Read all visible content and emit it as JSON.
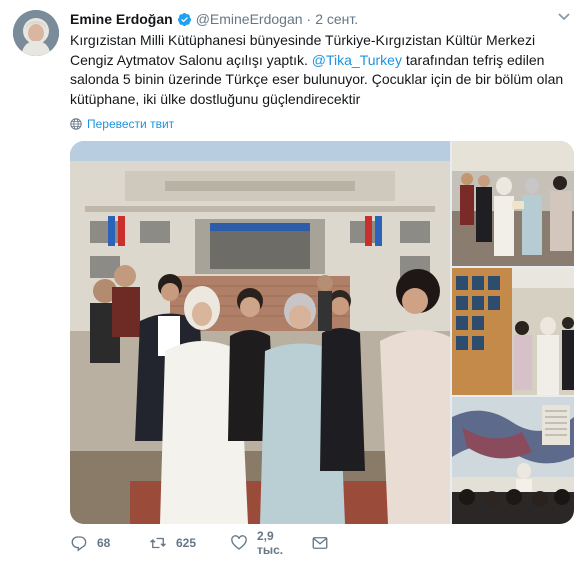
{
  "author": {
    "name": "Emine Erdoğan",
    "handle": "@EmineErdogan",
    "separator": "·",
    "time": "2 сент."
  },
  "tweet": {
    "text_before": "Kırgızistan Milli Kütüphanesi bünyesinde Türkiye-Kırgızistan Kültür Merkezi Cengiz Aytmatov Salonu açılışı yaptık. ",
    "mention": "@Tika_Turkey",
    "text_after": " tarafından tefriş edilen salonda 5 binin üzerinde Türkçe eser bulunuyor. Çocuklar için de bir bölüm olan kütüphane, iki ülke dostluğunu güçlendirecektir"
  },
  "translate_label": "Перевести твит",
  "actions": {
    "replies": "68",
    "retweets": "625",
    "likes": "2,9 тыс."
  },
  "colors": {
    "link": "#1b95e0",
    "secondary_text": "#657786",
    "primary_text": "#14171a"
  },
  "icons": [
    "avatar-photo",
    "verified-badge-icon",
    "caret-down-icon",
    "globe-icon",
    "reply-icon",
    "retweet-icon",
    "like-heart-icon",
    "direct-message-icon"
  ]
}
